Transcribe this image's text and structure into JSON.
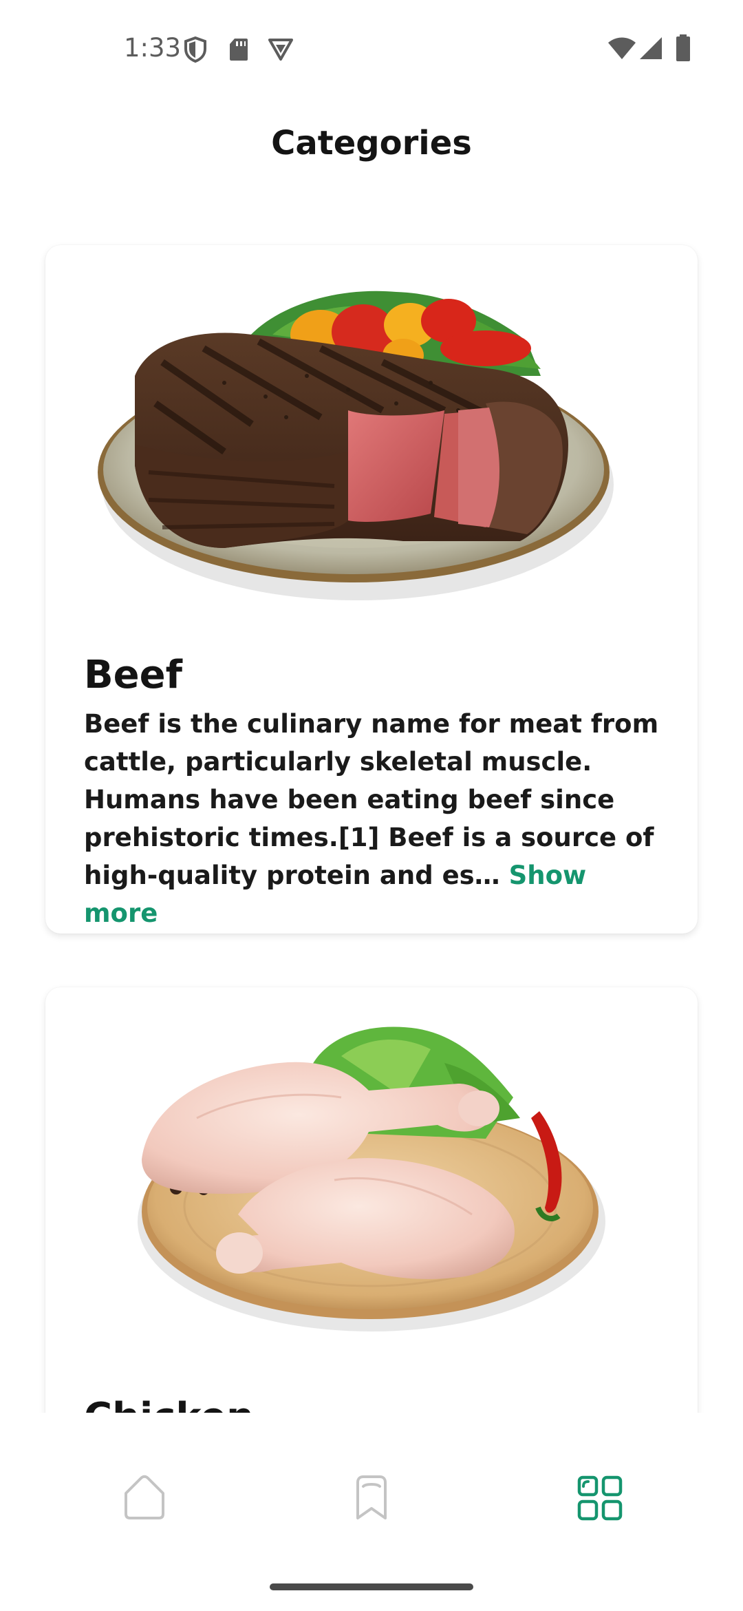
{
  "status_bar": {
    "time": "1:33",
    "icons": [
      "shield-icon",
      "sd-card-icon",
      "vpn-badge-icon",
      "wifi-icon",
      "signal-icon",
      "battery-icon"
    ]
  },
  "header": {
    "title": "Categories"
  },
  "categories": [
    {
      "title": "Beef",
      "description": "Beef is the culinary name for meat from cattle, particularly skeletal muscle. Humans have been eating beef since prehistoric times.[1] Beef is a source of high-quality protein and es…",
      "show_more": "Show more",
      "image": "grilled-steak-plate"
    },
    {
      "title": "Chicken",
      "image": "raw-chicken-legs-board"
    }
  ],
  "bottom_nav": {
    "items": [
      {
        "name": "home",
        "icon": "home-icon",
        "active": false
      },
      {
        "name": "bookmarks",
        "icon": "bookmark-icon",
        "active": false
      },
      {
        "name": "categories",
        "icon": "grid-icon",
        "active": true
      }
    ]
  },
  "colors": {
    "accent": "#15956e",
    "inactive_icon": "#c4c4c4",
    "text": "#141414"
  }
}
